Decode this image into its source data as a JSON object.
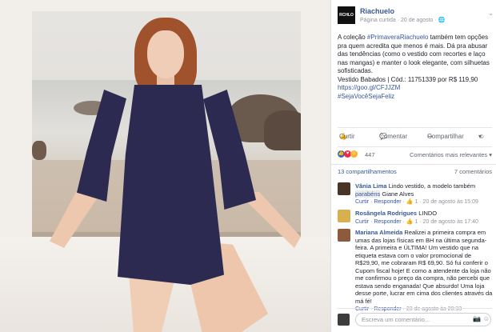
{
  "photo": {
    "alt": ""
  },
  "post": {
    "page_logo_text": "RCHLO",
    "page_name": "Riachuelo",
    "meta": "Página curtida · 20 de agosto · ",
    "globe": "🌐",
    "options": "⌄",
    "text_part1": "A coleção ",
    "hashtag1": "#PrimaveraRiachuelo",
    "text_part2": " também tem opções pra quem acredita que menos é mais. Dá pra abusar das tendências (como o vestido com recortes e laço nas mangas) e manter o look elegante, com silhuetas sofisticadas.",
    "product_line": "Vestido Babados | Cód.: 11751339 por R$ 119,90",
    "link": "https://goo.gl/CFJJZM",
    "hashtag2": "#SejaVocêSejaFeliz"
  },
  "actions": {
    "like": "Curtir",
    "comment": "Comentar",
    "share": "Compartilhar"
  },
  "reactions": {
    "count": "447",
    "relevant": "Comentários mais relevantes ▾"
  },
  "counts": {
    "shares": "13 compartilhamentos",
    "comments": "7 comentários"
  },
  "comments": [
    {
      "name": "Vânia Lima",
      "text": "Lindo vestido, a modelo também",
      "mention_a": "parabéns",
      "mention_b": "Giane Alves",
      "like": "Curtir",
      "reply": "Responder",
      "likes": "1",
      "time": "20 de agosto às 15:09"
    },
    {
      "name": "Rosângela Rodrigues",
      "text": "LINDO",
      "like": "Curtir",
      "reply": "Responder",
      "likes": "1",
      "time": "20 de agosto às 17:40"
    },
    {
      "name": "Mariana Almeida",
      "text": "Realizei a primeira compra em umas das lojas físicas em BH na última segunda-feira. A primeira e ÚLTIMA! Um vestido que na etiqueta estava com o valor promocional de R$29,90, me cobraram R$ 69,90. Só fui conferir o Cupom fiscal hoje! E como a atendente da loja não me confirmou o preço da compra, não percebi que estava sendo enganada! Que absurdo! Uma loja desse porte, lucrar em cima dos clientes através da má fé!",
      "like": "Curtir",
      "reply": "Responder",
      "time": "23 de agosto às 20:33"
    }
  ],
  "composer": {
    "placeholder": "Escreva um comentário..."
  },
  "colors": {
    "link": "#365899",
    "meta": "#90949c",
    "dress": "#2d2a52",
    "like_blue": "#4267b2",
    "love_red": "#f0284a",
    "haha_yellow": "#f7b125"
  }
}
